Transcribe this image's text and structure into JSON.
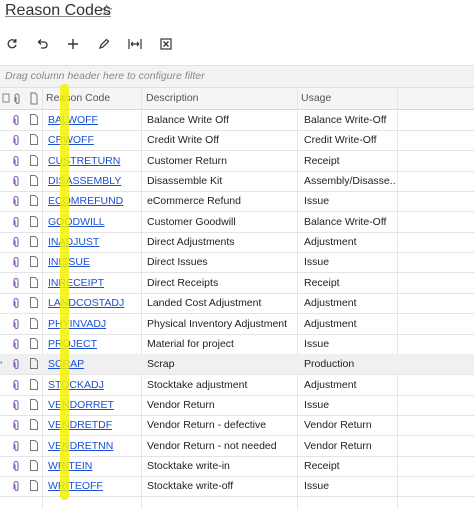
{
  "header": {
    "title": "Reason Codes"
  },
  "toolbar": {
    "buttons": [
      "refresh-icon",
      "undo-icon",
      "add-icon",
      "edit-icon",
      "fit-columns-icon",
      "export-excel-icon"
    ]
  },
  "grid": {
    "group_hint": "Drag column header here to configure filter",
    "columns": {
      "code": "Reason Code",
      "description": "Description",
      "usage": "Usage"
    },
    "rows": [
      {
        "code": "BALWOFF",
        "description": "Balance Write Off",
        "usage": "Balance Write-Off"
      },
      {
        "code": "CRWOFF",
        "description": "Credit Write Off",
        "usage": "Credit Write-Off"
      },
      {
        "code": "CUSTRETURN",
        "description": "Customer Return",
        "usage": "Receipt"
      },
      {
        "code": "DISASSEMBLY",
        "description": "Disassemble Kit",
        "usage": "Assembly/Disasse..."
      },
      {
        "code": "ECOMREFUND",
        "description": "eCommerce Refund",
        "usage": "Issue"
      },
      {
        "code": "GOODWILL",
        "description": "Customer Goodwill",
        "usage": "Balance Write-Off"
      },
      {
        "code": "INADJUST",
        "description": "Direct Adjustments",
        "usage": "Adjustment"
      },
      {
        "code": "INISSUE",
        "description": "Direct Issues",
        "usage": "Issue"
      },
      {
        "code": "INRECEIPT",
        "description": "Direct Receipts",
        "usage": "Receipt"
      },
      {
        "code": "LANDCOSTADJ",
        "description": "Landed Cost Adjustment",
        "usage": "Adjustment"
      },
      {
        "code": "PHYINVADJ",
        "description": "Physical Inventory Adjustment",
        "usage": "Adjustment"
      },
      {
        "code": "PROJECT",
        "description": "Material for project",
        "usage": "Issue"
      },
      {
        "code": "SCRAP",
        "description": "Scrap",
        "usage": "Production"
      },
      {
        "code": "STOCKADJ",
        "description": "Stocktake adjustment",
        "usage": "Adjustment"
      },
      {
        "code": "VENDORRET",
        "description": "Vendor Return",
        "usage": "Issue"
      },
      {
        "code": "VENDRETDF",
        "description": "Vendor Return - defective",
        "usage": "Vendor Return"
      },
      {
        "code": "VENDRETNN",
        "description": "Vendor Return - not needed",
        "usage": "Vendor Return"
      },
      {
        "code": "WRITEIN",
        "description": "Stocktake write-in",
        "usage": "Receipt"
      },
      {
        "code": "WRITEOFF",
        "description": "Stocktake write-off",
        "usage": "Issue"
      }
    ],
    "selected_row": 12
  },
  "colors": {
    "link": "#1a4fd6",
    "highlight": "#f2f200",
    "header_bg": "#f5f5f5"
  }
}
